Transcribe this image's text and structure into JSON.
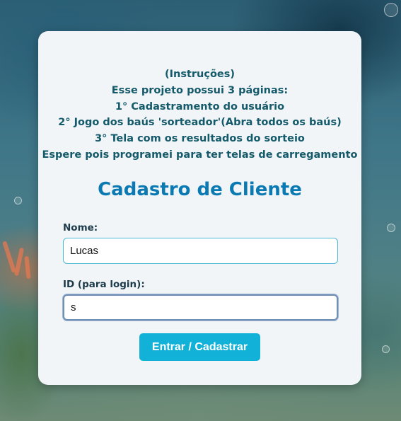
{
  "instructions": {
    "lines": [
      "(Instruções)",
      "Esse projeto possui 3 páginas:",
      "1° Cadastramento do usuário",
      "2° Jogo dos baús 'sorteador'(Abra todos os baús)",
      "3° Tela com os resultados do sorteio",
      "Espere pois programei para ter telas de carregamento"
    ]
  },
  "form": {
    "title": "Cadastro de Cliente",
    "name_label": "Nome:",
    "name_value": "Lucas",
    "id_label": "ID (para login):",
    "id_value": "s",
    "submit_label": "Entrar / Cadastrar"
  },
  "colors": {
    "card_background": "#f1f5f7",
    "instruction_text": "#145a6b",
    "title": "#0b79b2",
    "button": "#12b2d8",
    "button_text": "#ffffff",
    "name_border": "#4bb8d6"
  }
}
